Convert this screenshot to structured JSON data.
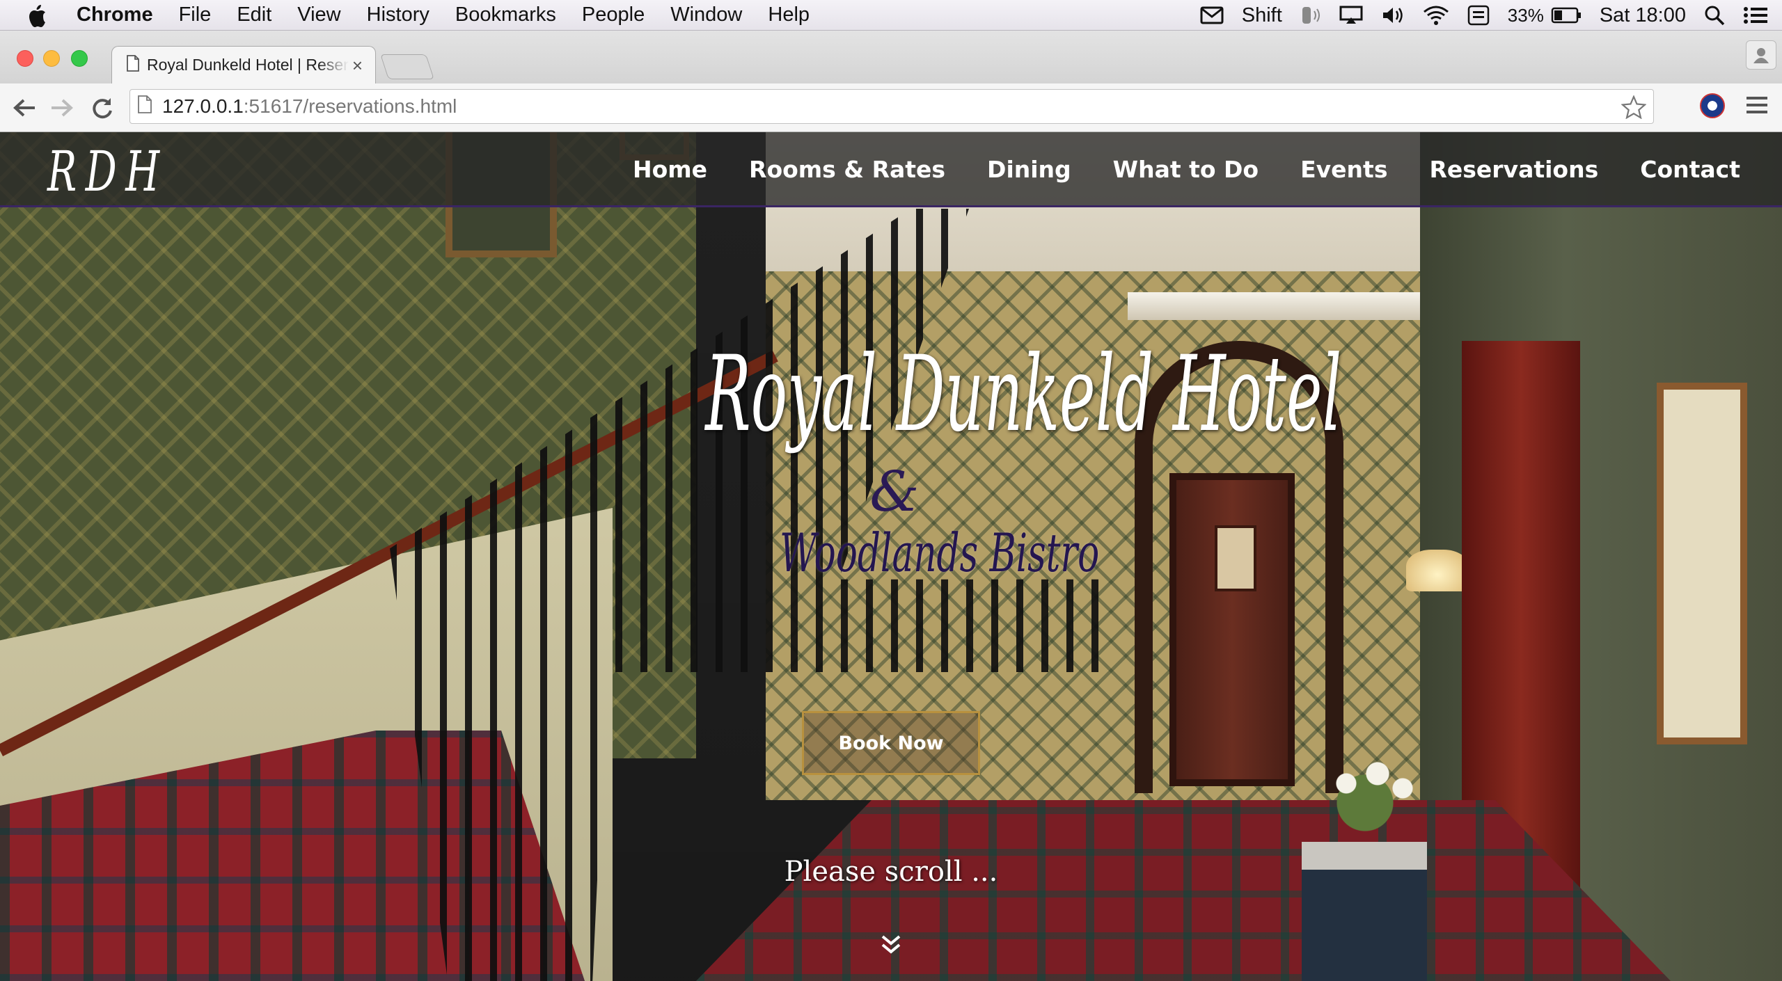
{
  "menubar": {
    "app_name": "Chrome",
    "items": [
      "File",
      "Edit",
      "View",
      "History",
      "Bookmarks",
      "People",
      "Window",
      "Help"
    ],
    "shift_label": "Shift",
    "battery_percent": "33%",
    "clock": "Sat 18:00"
  },
  "tab": {
    "title": "Royal Dunkeld Hotel | Reservations",
    "close_glyph": "×"
  },
  "address_bar": {
    "host": "127.0.0.1",
    "path": ":51617/reservations.html"
  },
  "site": {
    "logo": "RDH",
    "nav": [
      "Home",
      "Rooms & Rates",
      "Dining",
      "What to Do",
      "Events",
      "Reservations",
      "Contact"
    ],
    "hero_title": "Royal Dunkeld Hotel",
    "hero_ampersand": "&",
    "hero_subtitle": "Woodlands Bistro",
    "book_button": "Book Now",
    "scroll_prompt": "Please scroll ..."
  },
  "colors": {
    "nav_border": "#3a2563",
    "book_border": "#b8913e",
    "subtitle": "#241650"
  },
  "icons": {
    "menubar": [
      "apple-icon",
      "mail-icon",
      "volume-icon",
      "airplay-icon",
      "wifi-icon",
      "keyboard-icon",
      "battery-icon",
      "spotlight-icon",
      "notification-icon"
    ],
    "toolbar": [
      "back-icon",
      "forward-icon",
      "reload-icon",
      "page-icon",
      "star-icon",
      "extension-icon",
      "chrome-menu-icon"
    ]
  }
}
